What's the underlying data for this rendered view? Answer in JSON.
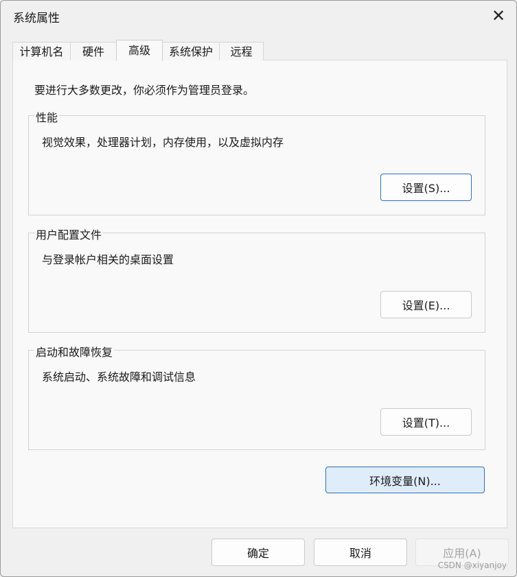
{
  "window": {
    "title": "系统属性",
    "close_icon": "close-icon",
    "close_glyph": "✕"
  },
  "tabs": [
    {
      "label": "计算机名",
      "active": false
    },
    {
      "label": "硬件",
      "active": false
    },
    {
      "label": "高级",
      "active": true
    },
    {
      "label": "系统保护",
      "active": false
    },
    {
      "label": "远程",
      "active": false
    }
  ],
  "notice": "要进行大多数更改，你必须作为管理员登录。",
  "groups": [
    {
      "label": "性能",
      "description": "视觉效果，处理器计划，内存使用，以及虚拟内存",
      "button": "设置(S)..."
    },
    {
      "label": "用户配置文件",
      "description": "与登录帐户相关的桌面设置",
      "button": "设置(E)..."
    },
    {
      "label": "启动和故障恢复",
      "description": "系统启动、系统故障和调试信息",
      "button": "设置(T)..."
    }
  ],
  "env_button": "环境变量(N)...",
  "footer": {
    "ok": "确定",
    "cancel": "取消",
    "apply": "应用(A)"
  },
  "watermark": "CSDN @xiyanjoy"
}
